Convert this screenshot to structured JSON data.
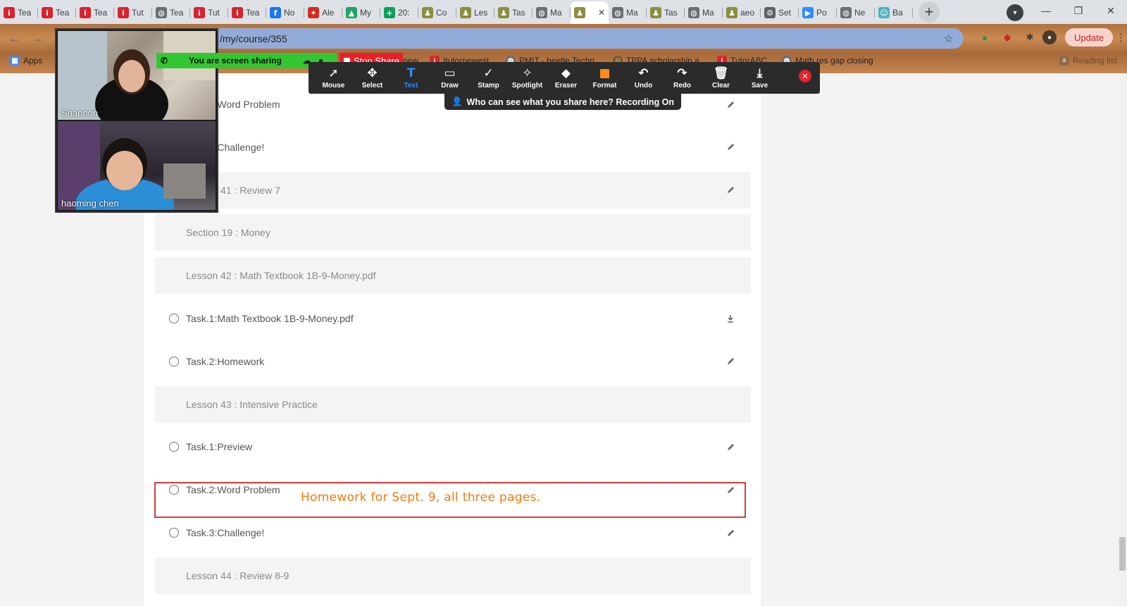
{
  "tabs": [
    {
      "label": "Tea",
      "icon": "i",
      "color": "#d9232d"
    },
    {
      "label": "Tea",
      "icon": "i",
      "color": "#d9232d"
    },
    {
      "label": "Tea",
      "icon": "i",
      "color": "#d9232d"
    },
    {
      "label": "Tut",
      "icon": "i",
      "color": "#d9232d"
    },
    {
      "label": "Tea",
      "icon": "◍",
      "color": "#6b6f74"
    },
    {
      "label": "Tut",
      "icon": "i",
      "color": "#d9232d"
    },
    {
      "label": "Tea",
      "icon": "i",
      "color": "#d9232d"
    },
    {
      "label": "No",
      "icon": "f",
      "color": "#1877f2"
    },
    {
      "label": "Ale",
      "icon": "✦",
      "color": "#d52b1e"
    },
    {
      "label": "My",
      "icon": "▲",
      "color": "#1fa463"
    },
    {
      "label": "20:",
      "icon": "+",
      "color": "#0f9d58"
    },
    {
      "label": "Co",
      "icon": "♟",
      "color": "#8d8d40"
    },
    {
      "label": "Les",
      "icon": "♟",
      "color": "#8d8d40"
    },
    {
      "label": "Tas",
      "icon": "♟",
      "color": "#8d8d40"
    },
    {
      "label": "Ma",
      "icon": "◍",
      "color": "#6b6f74"
    },
    {
      "label": "",
      "icon": "♟",
      "color": "#8d8d40",
      "active": true
    },
    {
      "label": "Ma",
      "icon": "◍",
      "color": "#6b6f74"
    },
    {
      "label": "Tas",
      "icon": "♟",
      "color": "#8d8d40"
    },
    {
      "label": "Ma",
      "icon": "◍",
      "color": "#6b6f74"
    },
    {
      "label": "aeo",
      "icon": "♟",
      "color": "#8d8d40"
    },
    {
      "label": "Set",
      "icon": "⚙",
      "color": "#5f6368"
    },
    {
      "label": "Po",
      "icon": "▶",
      "color": "#2d8cff"
    },
    {
      "label": "Ne",
      "icon": "◍",
      "color": "#6b6f74"
    },
    {
      "label": "Ba",
      "icon": "☺",
      "color": "#4fb3bf"
    }
  ],
  "address": {
    "url": "/my/course/355"
  },
  "update_label": "Update",
  "bookmarks": {
    "apps": "Apps",
    "new": "new",
    "itutor": "Itutornewest",
    "pmit": "PMIT - beetle Techn...",
    "tppa": "TPPA scholarship a...",
    "tutorabc": "TutorABC",
    "mathres": "Math res gap closing",
    "reading": "Reading list"
  },
  "zoom": {
    "sharing": "You are screen sharing",
    "stop_share": "Stop Share",
    "who_can_see": "Who can see what you share here? Recording On",
    "participants": [
      "Shannon",
      "haoming   chen"
    ],
    "tools": [
      {
        "label": "Mouse",
        "icon": "➚"
      },
      {
        "label": "Select",
        "icon": "✥"
      },
      {
        "label": "Text",
        "icon": "T",
        "active": true
      },
      {
        "label": "Draw",
        "icon": "▭"
      },
      {
        "label": "Stamp",
        "icon": "✓"
      },
      {
        "label": "Spotlight",
        "icon": "✧"
      },
      {
        "label": "Eraser",
        "icon": "◆"
      },
      {
        "label": "Format",
        "icon": "■"
      },
      {
        "label": "Undo",
        "icon": "↶"
      },
      {
        "label": "Redo",
        "icon": "↷"
      },
      {
        "label": "Clear",
        "icon": "🗑"
      },
      {
        "label": "Save",
        "icon": "⤓"
      }
    ]
  },
  "course": {
    "rows": [
      {
        "type": "task",
        "text": "Task.2:Word Problem",
        "action": "edit"
      },
      {
        "type": "task",
        "text": "Task.3:Challenge!",
        "action": "edit"
      },
      {
        "type": "header",
        "text": "Lesson 41 : Review 7",
        "action": "edit"
      },
      {
        "type": "header",
        "text": "Section 19 : Money"
      },
      {
        "type": "header",
        "text": "Lesson 42 : Math Textbook 1B-9-Money.pdf"
      },
      {
        "type": "task",
        "text": "Task.1:Math Textbook 1B-9-Money.pdf",
        "action": "download"
      },
      {
        "type": "task",
        "text": "Task.2:Homework",
        "action": "edit"
      },
      {
        "type": "header",
        "text": "Lesson 43 : Intensive Practice"
      },
      {
        "type": "task",
        "text": "Task.1:Preview",
        "action": "edit"
      },
      {
        "type": "task",
        "text": "Task.2:Word Problem",
        "action": "edit"
      },
      {
        "type": "task",
        "text": "Task.3:Challenge!",
        "action": "edit"
      },
      {
        "type": "header",
        "text": "Lesson 44 : Review 8-9"
      }
    ]
  },
  "annotation": {
    "text": "Homework for Sept. 9, all three pages.",
    "color": "#f27a12"
  }
}
